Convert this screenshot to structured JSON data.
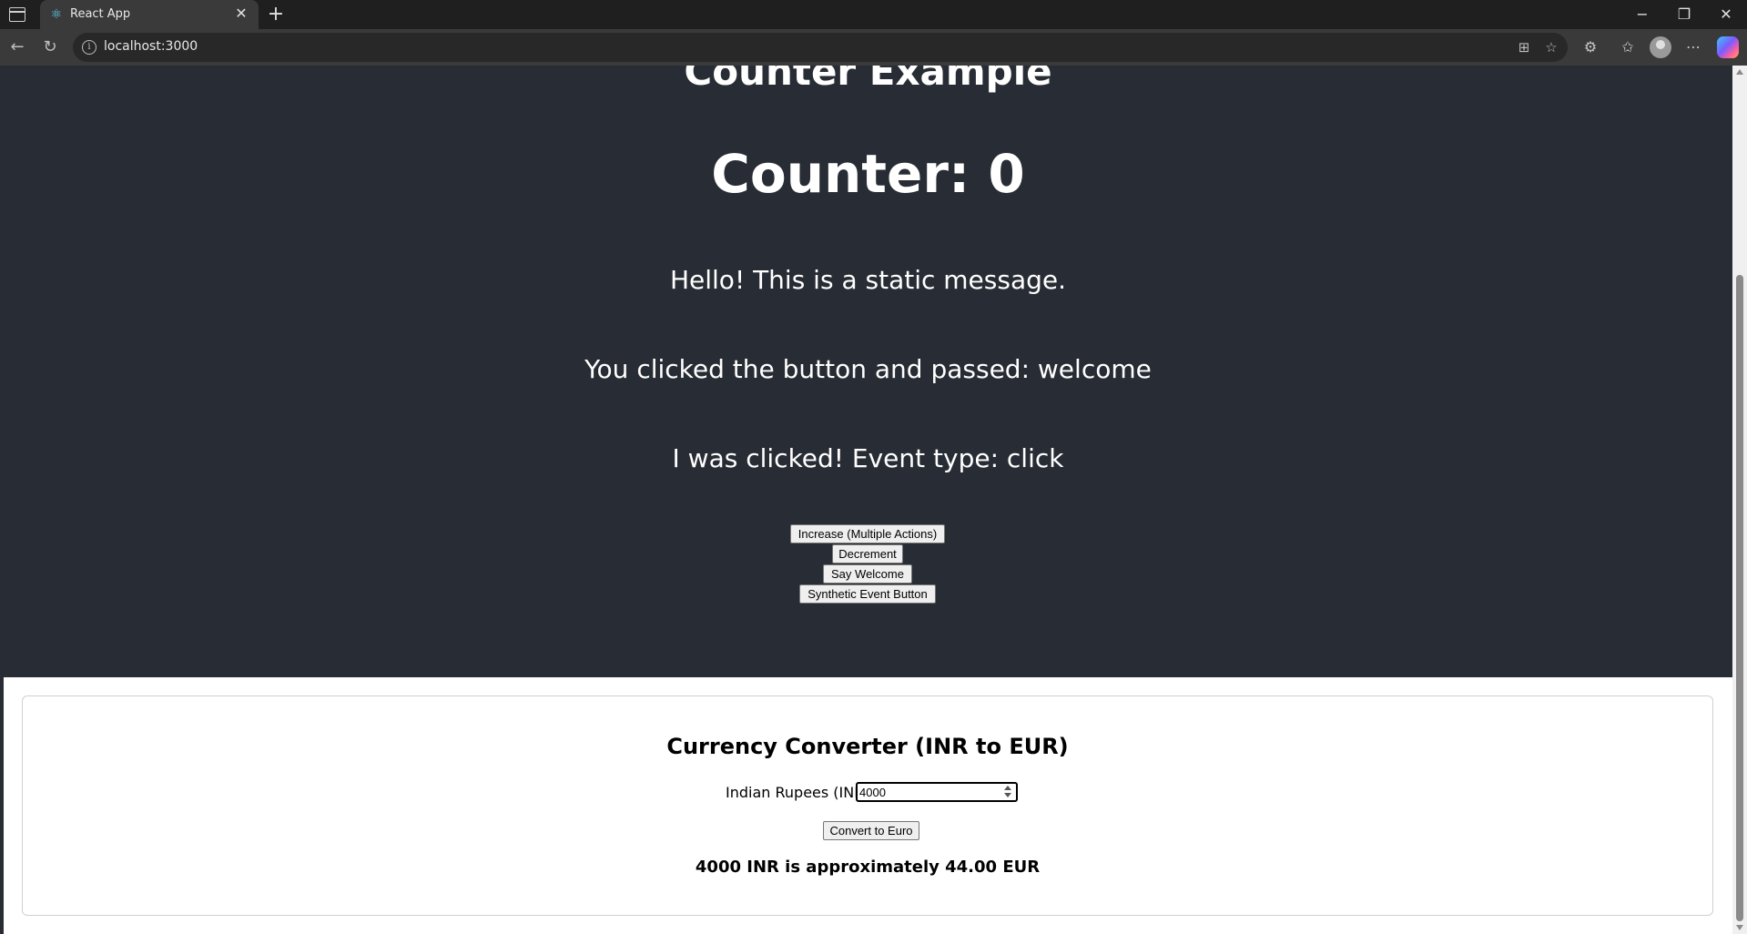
{
  "browser": {
    "tab_title": "React App",
    "url": "localhost:3000",
    "icons": [
      "tab-actions-icon",
      "react-favicon-icon",
      "close-icon",
      "plus-icon",
      "back-icon",
      "reload-icon",
      "info-icon",
      "split-screen-icon",
      "favorite-star-icon",
      "extensions-icon",
      "favorites-icon",
      "profile-icon",
      "more-icon",
      "copilot-icon",
      "minimize-icon",
      "restore-icon",
      "window-close-icon"
    ]
  },
  "app": {
    "page_title": "Counter Example",
    "counter_text": "Counter: 0",
    "static_message": "Hello! This is a static message.",
    "welcome_message": "You clicked the button and passed: welcome",
    "event_message": "I was clicked! Event type: click",
    "buttons": {
      "increase": "Increase (Multiple Actions)",
      "decrement": "Decrement",
      "say_welcome": "Say Welcome",
      "synthetic": "Synthetic Event Button"
    }
  },
  "converter": {
    "title": "Currency Converter (INR to EUR)",
    "inr_label": "Indian Rupees (INR):",
    "inr_value": "4000",
    "convert_button": "Convert to Euro",
    "result": "4000 INR is approximately 44.00 EUR"
  },
  "colors": {
    "app_background": "#282c34",
    "react_accent": "#61dafb"
  }
}
